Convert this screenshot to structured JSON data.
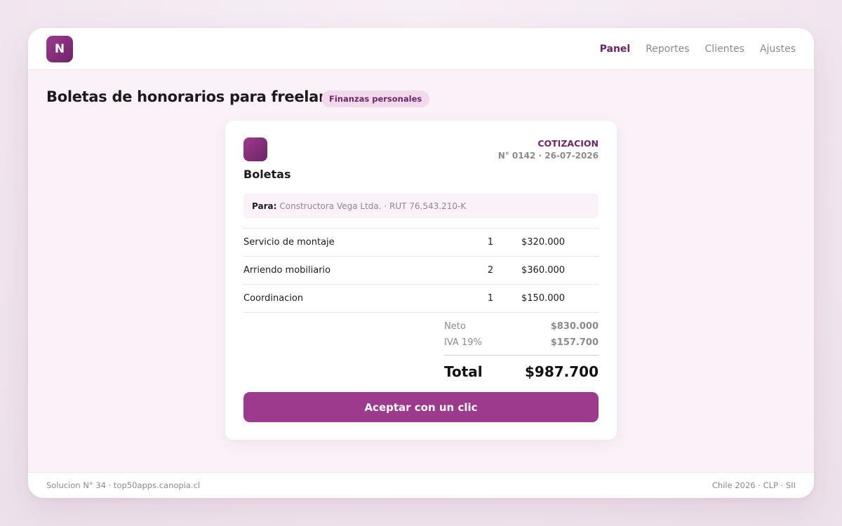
{
  "app": {
    "logo_letter": "N",
    "accent_color": "#9d3a8e",
    "nav": [
      {
        "label": "Panel",
        "active": true
      },
      {
        "label": "Reportes",
        "active": false
      },
      {
        "label": "Clientes",
        "active": false
      },
      {
        "label": "Ajustes",
        "active": false
      }
    ]
  },
  "page": {
    "title": "Boletas de honorarios para freelancers",
    "badge": "Finanzas personales"
  },
  "document": {
    "brand": "Boletas",
    "type": "COTIZACION",
    "meta": "N° 0142 · 26-07-2026",
    "recipient_label": "Para:",
    "recipient_value": "Constructora Vega Ltda. · RUT 76.543.210-K",
    "items": [
      {
        "description": "Servicio de montaje",
        "qty": "1",
        "price": "$320.000"
      },
      {
        "description": "Arriendo mobiliario",
        "qty": "2",
        "price": "$360.000"
      },
      {
        "description": "Coordinacion",
        "qty": "1",
        "price": "$150.000"
      }
    ],
    "neto_label": "Neto",
    "neto_value": "$830.000",
    "iva_label": "IVA 19%",
    "iva_value": "$157.700",
    "total_label": "Total",
    "total_value": "$987.700",
    "cta_label": "Aceptar con un clic"
  },
  "footer": {
    "left": "Solucion N° 34 · top50apps.canopia.cl",
    "right": "Chile 2026 · CLP · SII"
  }
}
